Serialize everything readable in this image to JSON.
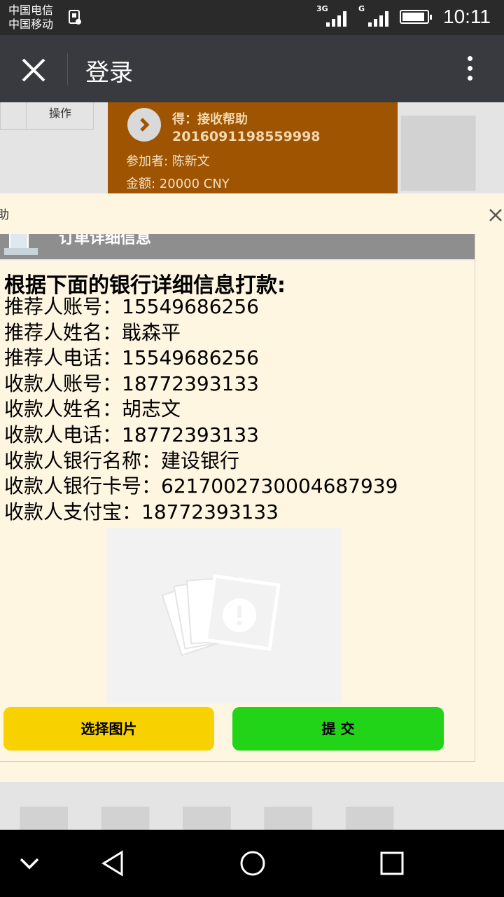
{
  "status_bar": {
    "carrier1": "中国电信",
    "carrier2": "中国移动",
    "net1": "3G",
    "net2": "G",
    "time": "10:11"
  },
  "title_bar": {
    "title": "登录"
  },
  "background": {
    "table_header": "操作",
    "card_type": "得：接收帮助",
    "card_id": "2016091198559998",
    "card_participant": "参加者: 陈新文",
    "card_amount": "金额: 20000 CNY"
  },
  "dialog": {
    "title": "助",
    "order_header": "订单详细信息",
    "info_heading": "根据下面的银行详细信息打款:",
    "info_rows": [
      "推荐人账号：15549686256",
      "推荐人姓名：戢森平",
      "推荐人电话：15549686256",
      "收款人账号：18772393133",
      "收款人姓名：胡志文",
      "收款人电话：18772393133",
      "收款人银行名称：建设银行",
      "收款人银行卡号：6217002730004687939",
      "收款人支付宝：18772393133"
    ],
    "choose_image_label": "选择图片",
    "submit_label": "提 交"
  },
  "colors": {
    "status_bg": "#2a2a2a",
    "title_bg": "#393a3f",
    "dialog_bg": "#fff6e2",
    "choose_btn": "#f7d100",
    "submit_btn": "#22d417",
    "card_bg": "#9e5400"
  }
}
